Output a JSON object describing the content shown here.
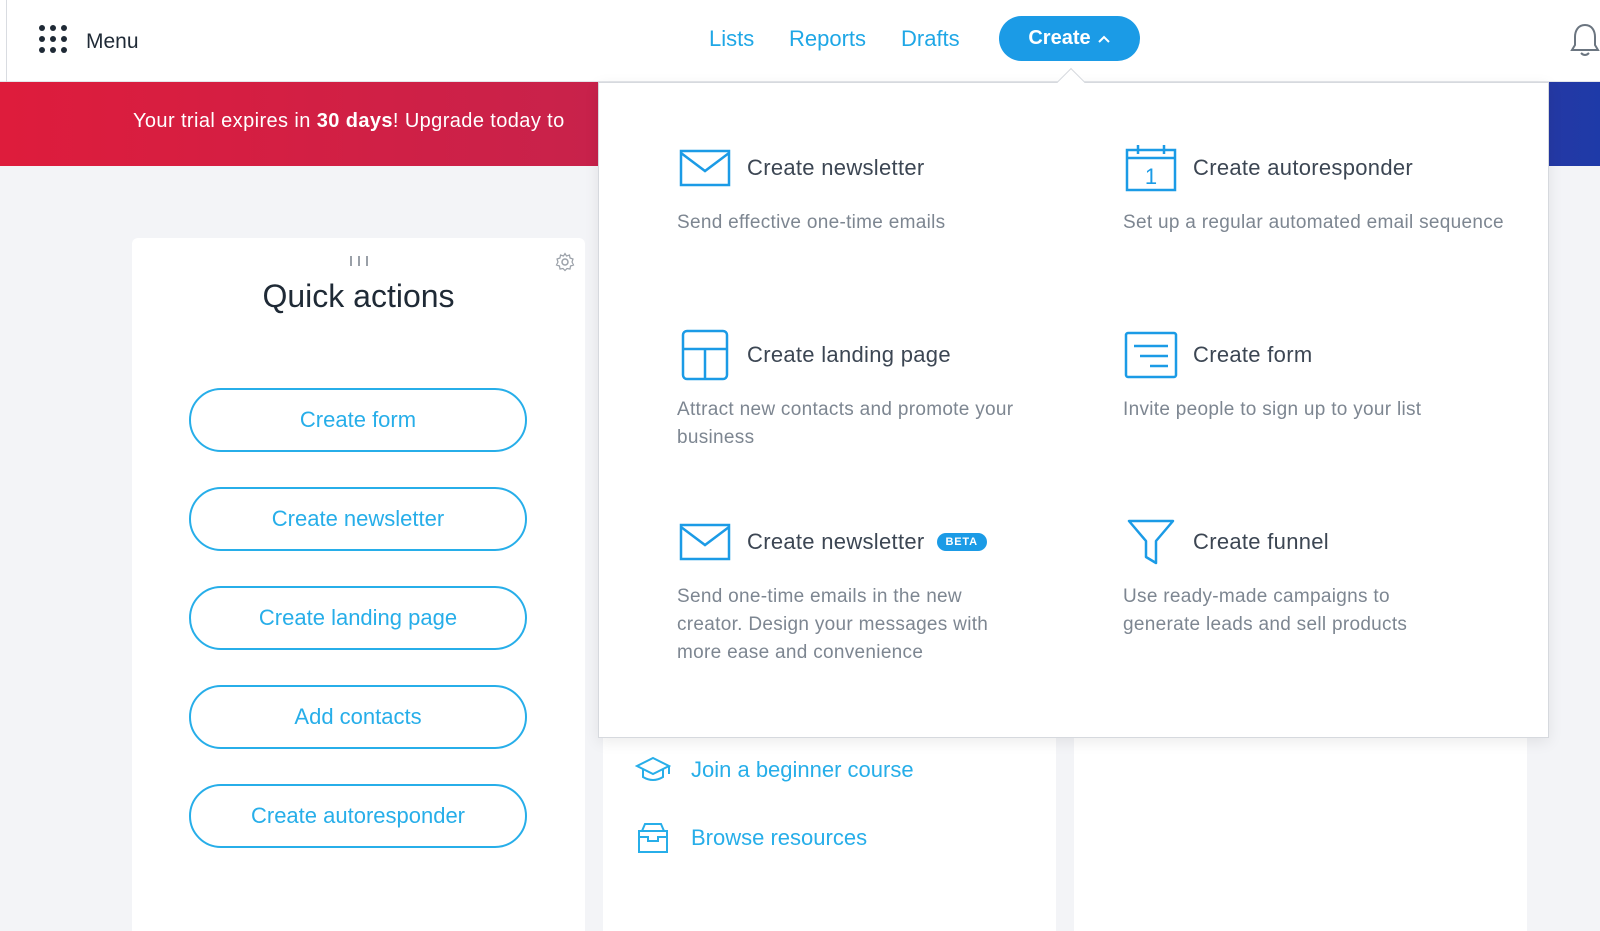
{
  "colors": {
    "accent": "#1b9be6",
    "link": "#27aee9",
    "trial_start": "#de1c3c",
    "trial_end": "#1e3aa8",
    "text_dark": "#1f2a36",
    "text_muted": "#7d8691"
  },
  "topbar": {
    "menu_label": "Menu",
    "menu_icon": "grid-dots-icon",
    "nav": {
      "lists": "Lists",
      "reports": "Reports",
      "drafts": "Drafts"
    },
    "create_label": "Create",
    "create_icon": "chevron-up-icon",
    "notifications_icon": "bell-icon"
  },
  "trial": {
    "prefix": "Your trial expires in ",
    "days": "30 days",
    "suffix": "! Upgrade today to"
  },
  "quick_actions": {
    "title": "Quick actions",
    "drag_icon": "drag-handle-icon",
    "settings_icon": "gear-icon",
    "buttons": [
      {
        "label": "Create form"
      },
      {
        "label": "Create newsletter"
      },
      {
        "label": "Create landing page"
      },
      {
        "label": "Add contacts"
      },
      {
        "label": "Create autoresponder"
      }
    ]
  },
  "resources": {
    "items": [
      {
        "label": "Join a beginner course",
        "icon": "graduation-cap-icon"
      },
      {
        "label": "Browse resources",
        "icon": "archive-box-icon"
      }
    ]
  },
  "create_menu": {
    "items": [
      {
        "title": "Create newsletter",
        "desc": "Send effective one-time emails",
        "icon": "envelope-icon"
      },
      {
        "title": "Create autoresponder",
        "desc": "Set up a regular automated email sequence",
        "icon": "calendar-icon",
        "icon_text": "1"
      },
      {
        "title": "Create landing page",
        "desc": "Attract new contacts and promote your business",
        "icon": "layout-icon"
      },
      {
        "title": "Create form",
        "desc": "Invite people to sign up to your list",
        "icon": "form-icon"
      },
      {
        "title": "Create newsletter",
        "desc": "Send one-time emails in the new creator. Design your messages with more ease and convenience",
        "icon": "envelope-icon",
        "badge": "BETA"
      },
      {
        "title": "Create funnel",
        "desc": "Use ready-made campaigns to generate leads and sell products",
        "icon": "funnel-icon"
      }
    ]
  }
}
